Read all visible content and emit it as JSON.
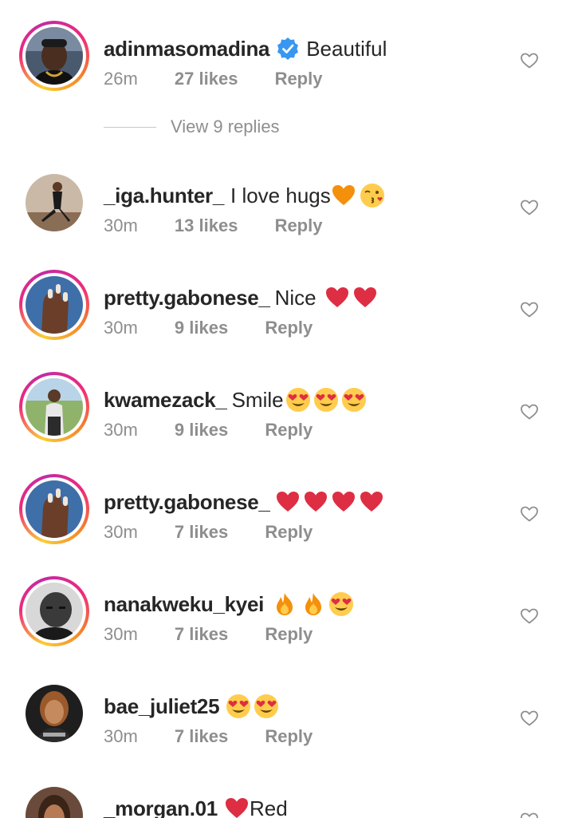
{
  "colors": {
    "username": "#262626",
    "meta": "#8e8e8e",
    "verified": "#3897f0",
    "heart_red": "#e0245e"
  },
  "comments": [
    {
      "username": "adinmasomadina",
      "verified": true,
      "text": "Beautiful",
      "time": "26m",
      "likes": "27 likes",
      "reply": "Reply",
      "avatar_ring": true,
      "avatar_icon": "avatar-man-portrait",
      "like_icon": "heart-outline-icon"
    },
    {
      "username": "_iga.hunter_",
      "text": "I love hugs",
      "emojis": [
        "orange-heart-emoji",
        "kissing-face-emoji"
      ],
      "time": "30m",
      "likes": "13 likes",
      "reply": "Reply",
      "avatar_ring": false,
      "avatar_icon": "avatar-woman-interior"
    },
    {
      "username": "pretty.gabonese_",
      "text": "Nice",
      "emojis": [
        "red-heart-emoji",
        "red-heart-emoji"
      ],
      "time": "30m",
      "likes": "9 likes",
      "reply": "Reply",
      "avatar_ring": true,
      "avatar_icon": "avatar-nails-hand"
    },
    {
      "username": "kwamezack_",
      "text": "Smile",
      "emojis": [
        "heart-eyes-emoji",
        "heart-eyes-emoji",
        "heart-eyes-emoji"
      ],
      "time": "30m",
      "likes": "9 likes",
      "reply": "Reply",
      "avatar_ring": true,
      "avatar_icon": "avatar-man-outdoors"
    },
    {
      "username": "pretty.gabonese_",
      "text": "",
      "emojis": [
        "red-heart-emoji",
        "red-heart-emoji",
        "red-heart-emoji",
        "red-heart-emoji"
      ],
      "time": "30m",
      "likes": "7 likes",
      "reply": "Reply",
      "avatar_ring": true,
      "avatar_icon": "avatar-nails-hand"
    },
    {
      "username": "nanakweku_kyei",
      "text": "",
      "emojis": [
        "fire-emoji",
        "fire-emoji",
        "heart-eyes-emoji"
      ],
      "time": "30m",
      "likes": "7 likes",
      "reply": "Reply",
      "avatar_ring": true,
      "avatar_icon": "avatar-man-bw"
    },
    {
      "username": "bae_juliet25",
      "text": "",
      "emojis": [
        "heart-eyes-emoji",
        "heart-eyes-emoji"
      ],
      "time": "30m",
      "likes": "7 likes",
      "reply": "Reply",
      "avatar_ring": false,
      "avatar_icon": "avatar-woman-portrait"
    },
    {
      "username": "_morgan.01",
      "text": "Red",
      "emojis": [
        "red-heart-emoji"
      ],
      "time": "",
      "likes": "",
      "reply": "",
      "avatar_ring": false,
      "avatar_icon": "avatar-woman-partial"
    }
  ],
  "view_replies": "View 9 replies"
}
